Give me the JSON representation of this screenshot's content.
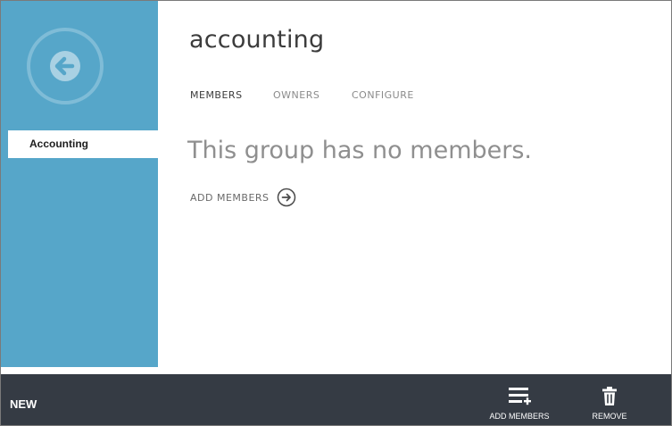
{
  "page": {
    "title": "accounting"
  },
  "colors": {
    "sidebar": "#56a6c9",
    "bottom_bar": "#353b44",
    "title_text": "#3c3c3c",
    "muted_text": "#8f8f8f"
  },
  "sidebar": {
    "back_button_icon": "back-arrow-circle-icon",
    "items": [
      {
        "label": "Accounting",
        "selected": true
      }
    ]
  },
  "tabs": [
    {
      "label": "MEMBERS",
      "active": true
    },
    {
      "label": "OWNERS",
      "active": false
    },
    {
      "label": "CONFIGURE",
      "active": false
    }
  ],
  "main": {
    "empty_message": "This group has no members.",
    "add_members_link": "ADD MEMBERS",
    "add_members_icon": "arrow-right-circle-icon"
  },
  "command_bar": {
    "new_label": "NEW",
    "commands": [
      {
        "label": "ADD MEMBERS",
        "icon": "add-list-icon"
      },
      {
        "label": "REMOVE",
        "icon": "trash-icon"
      }
    ]
  }
}
